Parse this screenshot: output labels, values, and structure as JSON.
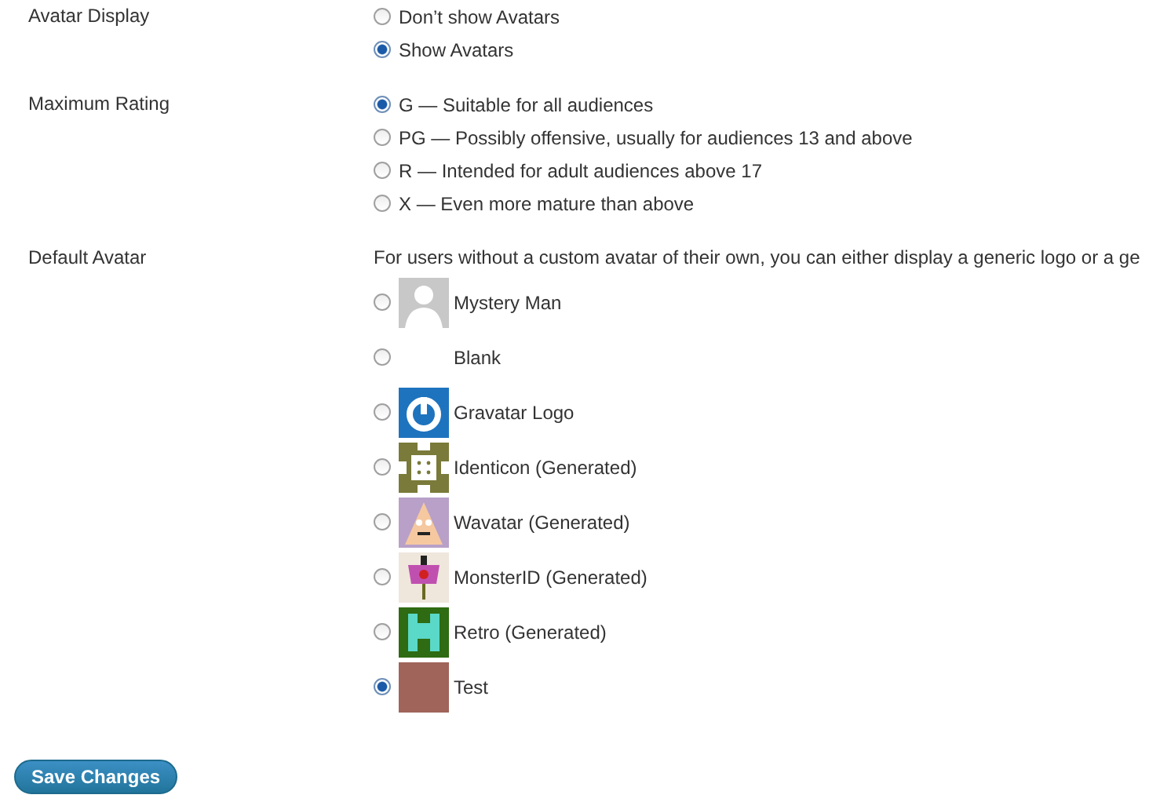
{
  "sections": [
    {
      "label": "Avatar Display",
      "options": [
        {
          "label": "Don’t show Avatars",
          "selected": false
        },
        {
          "label": "Show Avatars",
          "selected": true
        }
      ]
    },
    {
      "label": "Maximum Rating",
      "options": [
        {
          "label": "G — Suitable for all audiences",
          "selected": true
        },
        {
          "label": "PG — Possibly offensive, usually for audiences 13 and above",
          "selected": false
        },
        {
          "label": "R — Intended for adult audiences above 17",
          "selected": false
        },
        {
          "label": "X — Even more mature than above",
          "selected": false
        }
      ]
    }
  ],
  "default_avatar": {
    "label": "Default Avatar",
    "description": "For users without a custom avatar of their own, you can either display a generic logo or a ge",
    "options": [
      {
        "label": "Mystery Man",
        "kind": "mystery",
        "selected": false
      },
      {
        "label": "Blank",
        "kind": "blank",
        "selected": false
      },
      {
        "label": "Gravatar Logo",
        "kind": "gravatar",
        "selected": false
      },
      {
        "label": "Identicon (Generated)",
        "kind": "identicon",
        "selected": false
      },
      {
        "label": "Wavatar (Generated)",
        "kind": "wavatar",
        "selected": false
      },
      {
        "label": "MonsterID (Generated)",
        "kind": "monster",
        "selected": false
      },
      {
        "label": "Retro (Generated)",
        "kind": "retro",
        "selected": false
      },
      {
        "label": "Test",
        "kind": "photo",
        "selected": true
      }
    ]
  },
  "save_button": "Save Changes"
}
